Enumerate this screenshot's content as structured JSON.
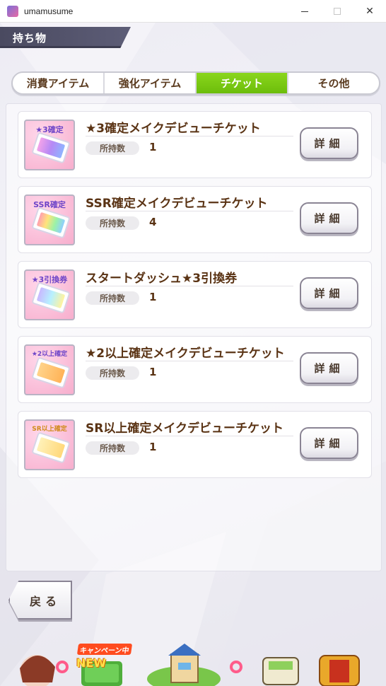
{
  "window": {
    "title": "umamusume",
    "minimize_glyph": "",
    "maximize_glyph": "",
    "close_glyph": "✕"
  },
  "header": {
    "title": "持ち物"
  },
  "tabs": [
    {
      "label": "消費アイテム",
      "active": false
    },
    {
      "label": "強化アイテム",
      "active": false
    },
    {
      "label": "チケット",
      "active": true
    },
    {
      "label": "その他",
      "active": false
    }
  ],
  "items": [
    {
      "name": "★3確定メイクデビューチケット",
      "qty_label": "所持数",
      "qty": "1",
      "icon_label": "★3確定",
      "icon": "ticket-purple-icon"
    },
    {
      "name": "SSR確定メイクデビューチケット",
      "qty_label": "所持数",
      "qty": "4",
      "icon_label": "SSR確定",
      "icon": "ticket-rainbow-icon"
    },
    {
      "name": "スタートダッシュ★3引換券",
      "qty_label": "所持数",
      "qty": "1",
      "icon_label": "★3引換券",
      "icon": "ticket-stars-icon"
    },
    {
      "name": "★2以上確定メイクデビューチケット",
      "qty_label": "所持数",
      "qty": "1",
      "icon_label": "★2以上確定",
      "icon": "ticket-orange-icon"
    },
    {
      "name": "SR以上確定メイクデビューチケット",
      "qty_label": "所持数",
      "qty": "1",
      "icon_label": "SR以上確定",
      "icon": "ticket-gold-icon"
    }
  ],
  "detail_label": "詳細",
  "back_label": "戻る",
  "bottom_nav": {
    "campaign_badge": "キャンペーン中",
    "new_badge": "NEW"
  },
  "colors": {
    "active_tab": "#7ac914",
    "text_brown": "#5a3314",
    "header_ribbon": "#55556e"
  }
}
